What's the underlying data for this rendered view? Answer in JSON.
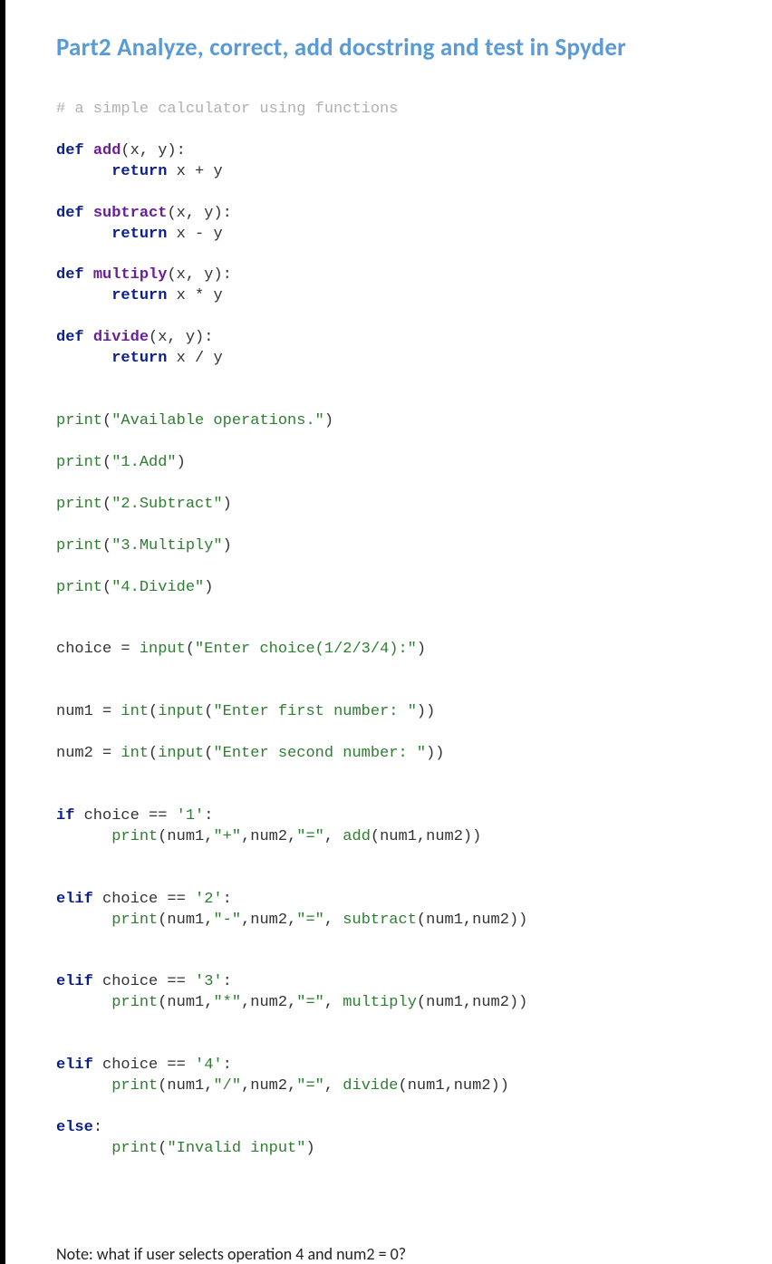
{
  "title": "Part2 Analyze, correct, add docstring and test in Spyder",
  "comment": "# a simple calculator using functions",
  "kw": {
    "def": "def",
    "return": "return",
    "if": "if",
    "elif": "elif",
    "else": "else"
  },
  "fn": {
    "add": "add",
    "subtract": "subtract",
    "multiply": "multiply",
    "divide": "divide",
    "print": "print",
    "input": "input",
    "int": "int"
  },
  "sig": {
    "xy": "(x, y):",
    "ret_add": " x + y",
    "ret_sub": " x - y",
    "ret_mul": " x * y",
    "ret_div": " x / y"
  },
  "str": {
    "avail": "\"Available operations.\"",
    "opt1": "\"1.Add\"",
    "opt2": "\"2.Subtract\"",
    "opt3": "\"3.Multiply\"",
    "opt4": "\"4.Divide\"",
    "enter_choice": "\"Enter choice(1/2/3/4):\"",
    "enter1": "\"Enter first number: \"",
    "enter2": "\"Enter second number: \"",
    "c1": "'1'",
    "c2": "'2'",
    "c3": "'3'",
    "c4": "'4'",
    "plus": "\"+\"",
    "minus": "\"-\"",
    "star": "\"*\"",
    "slash": "\"/\"",
    "eq": "\"=\"",
    "invalid": "\"Invalid input\""
  },
  "txt": {
    "choice_assign": "choice = ",
    "num1_assign": "num1 = ",
    "num2_assign": "num2 = ",
    "if_choice": " choice == ",
    "print_open": "(num1,",
    "mid": ",num2,",
    "comma_sp": ", ",
    "args": "(num1,num2))",
    "colon": ":",
    "open": "(",
    "close": ")",
    "close2": "))",
    "indent": "      ",
    "cond_close": ":"
  },
  "note": "Note: what if user selects operation 4 and num2 = 0?"
}
